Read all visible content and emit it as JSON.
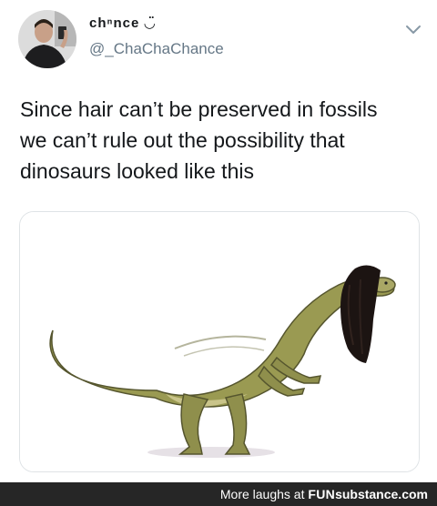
{
  "tweet": {
    "display_name": "chⁿnce ◡̈",
    "handle": "@_ChaChaChance",
    "text_lines": [
      "Since hair can’t be preserved in fossils",
      "we can’t rule out the possibility that",
      "dinosaurs looked like this"
    ]
  },
  "footer": {
    "prefix": "More laughs at",
    "brand_bold": "FUN",
    "brand_rest": "substance.com"
  },
  "colors": {
    "handle_gray": "#657786",
    "footer_bg": "#262626",
    "dino_green": "#9a9a52",
    "hair_black": "#1c1412"
  },
  "icons": {
    "chevron": "chevron-down-icon"
  }
}
